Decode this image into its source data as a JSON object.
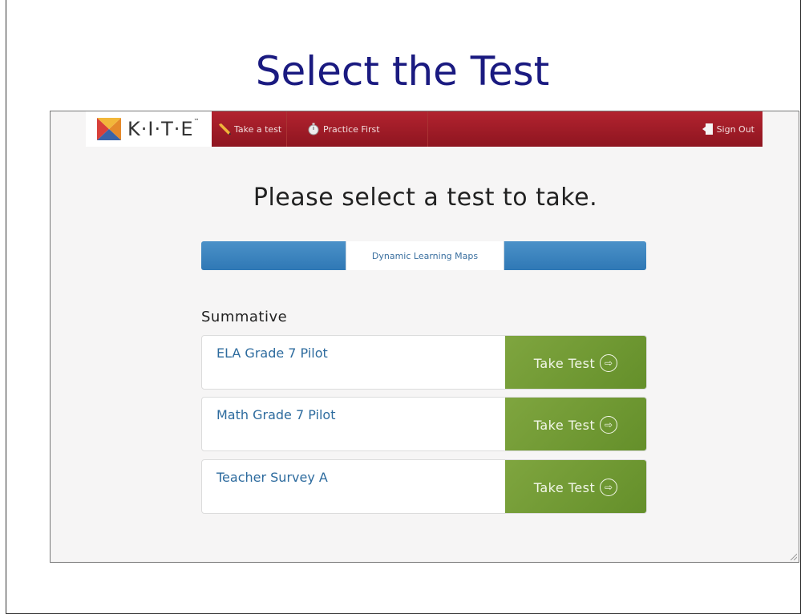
{
  "slide": {
    "title": "Select the Test"
  },
  "app": {
    "logo_text": "K·I·T·E",
    "logo_trademark": "™",
    "nav": {
      "take_test": "Take a test",
      "practice_first": "Practice First",
      "sign_out": "Sign Out"
    },
    "heading": "Please select a test to take.",
    "tabs": [
      {
        "label": "Dynamic Learning Maps",
        "active": true
      }
    ],
    "section": "Summative",
    "tests": [
      {
        "name": "ELA Grade 7 Pilot",
        "button": "Take Test"
      },
      {
        "name": "Math Grade 7 Pilot",
        "button": "Take Test"
      },
      {
        "name": "Teacher Survey A",
        "button": "Take Test"
      }
    ]
  },
  "colors": {
    "title": "#1a1a80",
    "topbar": "#a01c28",
    "tabbar": "#3b84bf",
    "take_button": "#72992f",
    "test_name": "#2d6b9e"
  },
  "icons": [
    "kite-logo-icon",
    "pencil-icon",
    "stopwatch-icon",
    "sign-out-icon",
    "arrow-right-circle-icon"
  ]
}
